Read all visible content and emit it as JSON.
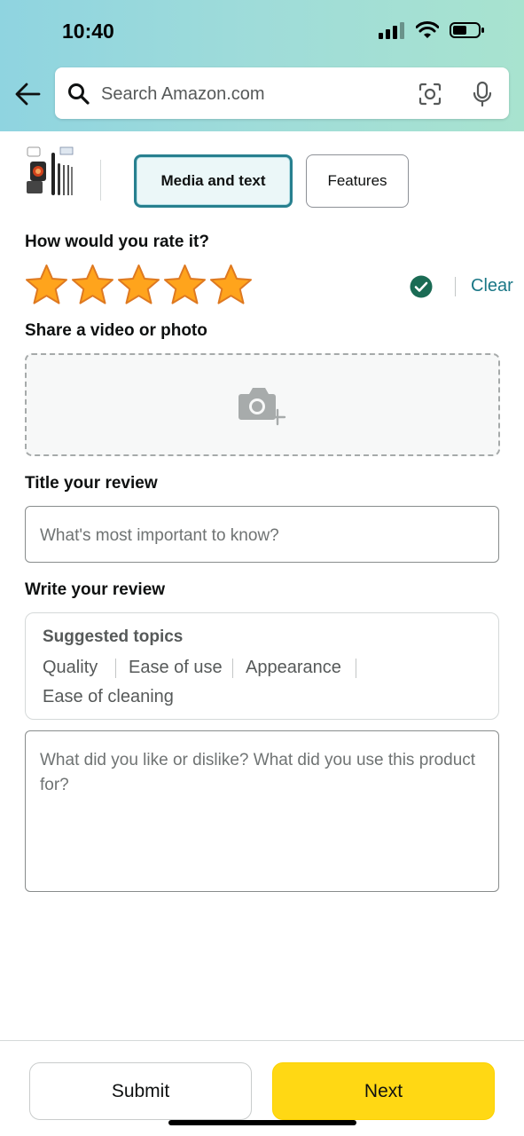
{
  "status_bar": {
    "time": "10:40"
  },
  "search": {
    "placeholder": "Search Amazon.com"
  },
  "tabs": [
    {
      "label": "Media and text",
      "active": true
    },
    {
      "label": "Features",
      "active": false
    }
  ],
  "rating": {
    "heading": "How would you rate it?",
    "stars": 5,
    "max_stars": 5,
    "clear_label": "Clear"
  },
  "media": {
    "heading": "Share a video or photo"
  },
  "title_review": {
    "heading": "Title your review",
    "placeholder": "What's most important to know?"
  },
  "write_review": {
    "heading": "Write your review",
    "suggested_title": "Suggested topics",
    "topics": [
      "Quality",
      "Ease of use",
      "Appearance",
      "Ease of cleaning"
    ],
    "placeholder": "What did you like or dislike? What did you use this product for?"
  },
  "footer": {
    "submit_label": "Submit",
    "next_label": "Next"
  },
  "colors": {
    "accent_teal": "#27808f",
    "link": "#1a7786",
    "star": "#ffa41c",
    "next_button": "#ffd814",
    "check": "#1a6b54"
  },
  "icons": [
    "back-arrow-icon",
    "search-icon",
    "camera-lens-icon",
    "microphone-icon",
    "star-icon",
    "checkmark-circle-icon",
    "add-photo-camera-icon",
    "signal-icon",
    "wifi-icon",
    "battery-icon"
  ]
}
